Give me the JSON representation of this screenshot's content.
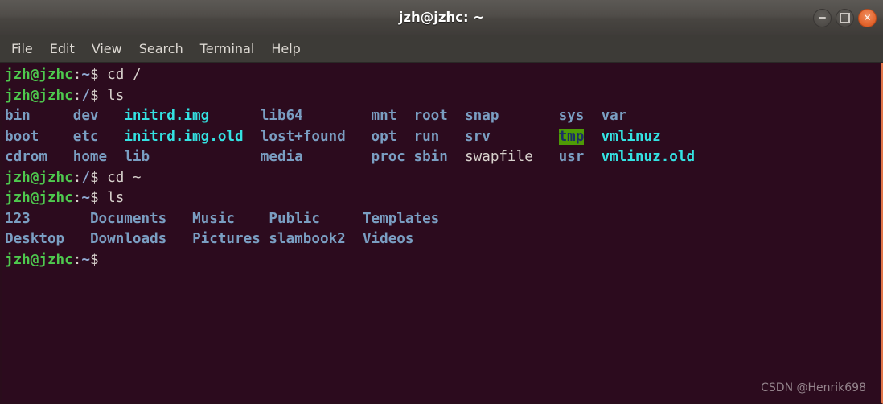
{
  "window": {
    "title": "jzh@jzhc: ~",
    "controls": [
      {
        "name": "minimize",
        "glyph": "–"
      },
      {
        "name": "maximize",
        "glyph": "□"
      },
      {
        "name": "close",
        "glyph": "✕"
      }
    ]
  },
  "menubar": {
    "items": [
      "File",
      "Edit",
      "View",
      "Search",
      "Terminal",
      "Help"
    ]
  },
  "terminal": {
    "colors": {
      "background": "#2c0b1e",
      "prompt_user": "#4ec94e",
      "directory": "#7a9ec2",
      "symlink": "#34e2e2",
      "regular_file": "#d8d2cd",
      "sticky_dir_bg": "#4e9a06",
      "sticky_dir_fg": "#1b2f66",
      "window_border": "#e2764a"
    },
    "prompt": {
      "user_host": "jzh@jzhc",
      "separator": ":",
      "symbol": "$"
    },
    "lines": [
      {
        "type": "prompt",
        "cwd": "~",
        "command": "cd /"
      },
      {
        "type": "prompt",
        "cwd": "/",
        "command": "ls"
      },
      {
        "type": "output",
        "cells": [
          {
            "text": "bin",
            "style": "dir"
          },
          {
            "text": "dev",
            "style": "dir"
          },
          {
            "text": "initrd.img",
            "style": "link"
          },
          {
            "text": "lib64",
            "style": "dir"
          },
          {
            "text": "mnt",
            "style": "dir"
          },
          {
            "text": "root",
            "style": "dir"
          },
          {
            "text": "snap",
            "style": "dir"
          },
          {
            "text": "sys",
            "style": "dir"
          },
          {
            "text": "var",
            "style": "dir"
          }
        ]
      },
      {
        "type": "output",
        "cells": [
          {
            "text": "boot",
            "style": "dir"
          },
          {
            "text": "etc",
            "style": "dir"
          },
          {
            "text": "initrd.img.old",
            "style": "link"
          },
          {
            "text": "lost+found",
            "style": "dir"
          },
          {
            "text": "opt",
            "style": "dir"
          },
          {
            "text": "run",
            "style": "dir"
          },
          {
            "text": "srv",
            "style": "dir"
          },
          {
            "text": "tmp",
            "style": "sticky"
          },
          {
            "text": "vmlinuz",
            "style": "link"
          }
        ]
      },
      {
        "type": "output",
        "cells": [
          {
            "text": "cdrom",
            "style": "dir"
          },
          {
            "text": "home",
            "style": "dir"
          },
          {
            "text": "lib",
            "style": "dir"
          },
          {
            "text": "media",
            "style": "dir"
          },
          {
            "text": "proc",
            "style": "dir"
          },
          {
            "text": "sbin",
            "style": "dir"
          },
          {
            "text": "swapfile",
            "style": "file"
          },
          {
            "text": "usr",
            "style": "dir"
          },
          {
            "text": "vmlinuz.old",
            "style": "link"
          }
        ]
      },
      {
        "type": "prompt",
        "cwd": "/",
        "command": "cd ~"
      },
      {
        "type": "prompt",
        "cwd": "~",
        "command": "ls"
      },
      {
        "type": "output",
        "cells": [
          {
            "text": "123",
            "style": "dir"
          },
          {
            "text": "Documents",
            "style": "dir"
          },
          {
            "text": "Music",
            "style": "dir"
          },
          {
            "text": "Public",
            "style": "dir"
          },
          {
            "text": "Templates",
            "style": "dir"
          }
        ]
      },
      {
        "type": "output",
        "cells": [
          {
            "text": "Desktop",
            "style": "dir"
          },
          {
            "text": "Downloads",
            "style": "dir"
          },
          {
            "text": "Pictures",
            "style": "dir"
          },
          {
            "text": "slambook2",
            "style": "dir"
          },
          {
            "text": "Videos",
            "style": "dir"
          }
        ]
      },
      {
        "type": "prompt",
        "cwd": "~",
        "command": ""
      }
    ],
    "columns_root": [
      0,
      8,
      14,
      30,
      43,
      48,
      54,
      65,
      70
    ],
    "columns_home": [
      0,
      10,
      22,
      31,
      42
    ]
  },
  "watermark": "CSDN @Henrik698"
}
